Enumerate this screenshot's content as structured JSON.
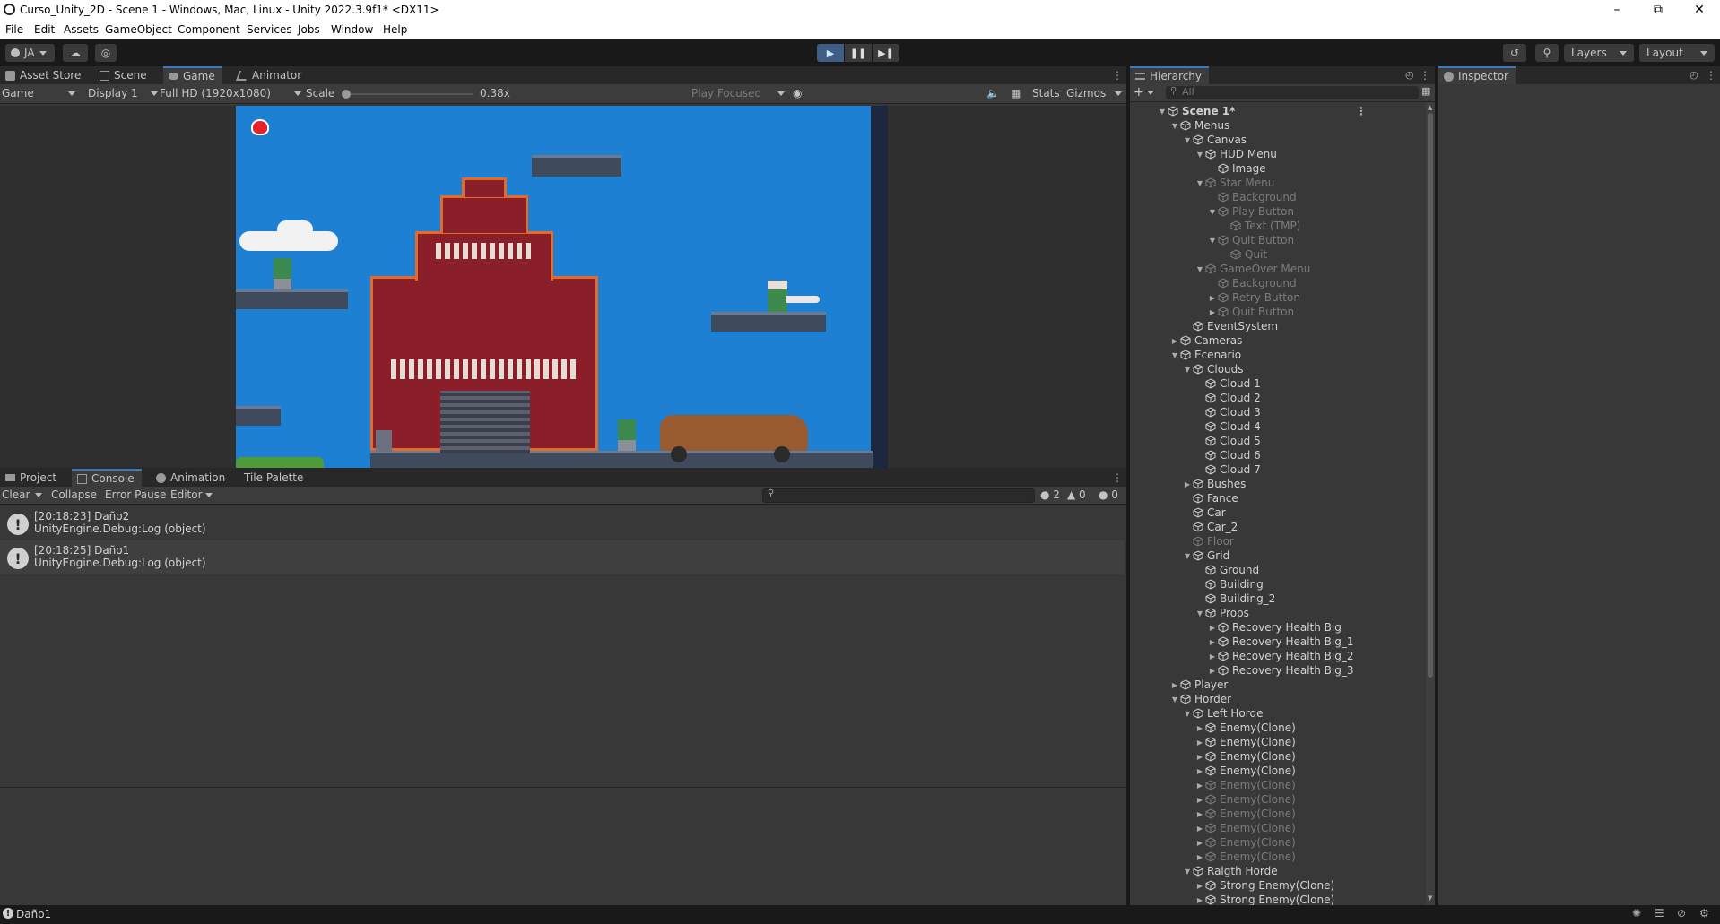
{
  "window": {
    "title": "Curso_Unity_2D - Scene 1 - Windows, Mac, Linux - Unity 2022.3.9f1* <DX11>"
  },
  "menu": [
    "File",
    "Edit",
    "Assets",
    "GameObject",
    "Component",
    "Services",
    "Jobs",
    "Window",
    "Help"
  ],
  "toolbar": {
    "account": "JA",
    "layers_label": "Layers",
    "layout_label": "Layout"
  },
  "scene_tabs": [
    "Asset Store",
    "Scene",
    "Game",
    "Animator"
  ],
  "game_bar": {
    "view": "Game",
    "display": "Display 1",
    "resolution": "Full HD (1920x1080)",
    "scale_label": "Scale",
    "scale_value": "0.38x",
    "play_mode": "Play Focused",
    "stats": "Stats",
    "gizmos": "Gizmos"
  },
  "bottom_tabs": [
    "Project",
    "Console",
    "Animation",
    "Tile Palette"
  ],
  "console_bar": {
    "clear": "Clear",
    "collapse": "Collapse",
    "error_pause": "Error Pause",
    "editor": "Editor",
    "count_log": "2",
    "count_warn": "0",
    "count_err": "0"
  },
  "console_logs": [
    {
      "line1": "[20:18:23] Daño2",
      "line2": "UnityEngine.Debug:Log (object)"
    },
    {
      "line1": "[20:18:25] Daño1",
      "line2": "UnityEngine.Debug:Log (object)"
    }
  ],
  "hierarchy": {
    "tab": "Hierarchy",
    "search_placeholder": "All",
    "items": [
      {
        "label": "Scene 1*",
        "depth": 0,
        "fold": "open",
        "dim": false,
        "bold": true
      },
      {
        "label": "Menus",
        "depth": 1,
        "fold": "open",
        "dim": false
      },
      {
        "label": "Canvas",
        "depth": 2,
        "fold": "open",
        "dim": false
      },
      {
        "label": "HUD Menu",
        "depth": 3,
        "fold": "open",
        "dim": false
      },
      {
        "label": "Image",
        "depth": 4,
        "fold": "none",
        "dim": false
      },
      {
        "label": "Star Menu",
        "depth": 3,
        "fold": "open",
        "dim": true
      },
      {
        "label": "Background",
        "depth": 4,
        "fold": "none",
        "dim": true
      },
      {
        "label": "Play Button",
        "depth": 4,
        "fold": "open",
        "dim": true
      },
      {
        "label": "Text (TMP)",
        "depth": 5,
        "fold": "none",
        "dim": true
      },
      {
        "label": "Quit Button",
        "depth": 4,
        "fold": "open",
        "dim": true
      },
      {
        "label": "Quit",
        "depth": 5,
        "fold": "none",
        "dim": true
      },
      {
        "label": "GameOver Menu",
        "depth": 3,
        "fold": "open",
        "dim": true
      },
      {
        "label": "Background",
        "depth": 4,
        "fold": "none",
        "dim": true
      },
      {
        "label": "Retry Button",
        "depth": 4,
        "fold": "closed",
        "dim": true
      },
      {
        "label": "Quit Button",
        "depth": 4,
        "fold": "closed",
        "dim": true
      },
      {
        "label": "EventSystem",
        "depth": 2,
        "fold": "none",
        "dim": false
      },
      {
        "label": "Cameras",
        "depth": 1,
        "fold": "closed",
        "dim": false
      },
      {
        "label": "Ecenario",
        "depth": 1,
        "fold": "open",
        "dim": false
      },
      {
        "label": "Clouds",
        "depth": 2,
        "fold": "open",
        "dim": false
      },
      {
        "label": "Cloud 1",
        "depth": 3,
        "fold": "none",
        "dim": false
      },
      {
        "label": "Cloud 2",
        "depth": 3,
        "fold": "none",
        "dim": false
      },
      {
        "label": "Cloud 3",
        "depth": 3,
        "fold": "none",
        "dim": false
      },
      {
        "label": "Cloud 4",
        "depth": 3,
        "fold": "none",
        "dim": false
      },
      {
        "label": "Cloud 5",
        "depth": 3,
        "fold": "none",
        "dim": false
      },
      {
        "label": "Cloud 6",
        "depth": 3,
        "fold": "none",
        "dim": false
      },
      {
        "label": "Cloud 7",
        "depth": 3,
        "fold": "none",
        "dim": false
      },
      {
        "label": "Bushes",
        "depth": 2,
        "fold": "closed",
        "dim": false
      },
      {
        "label": "Fance",
        "depth": 2,
        "fold": "none",
        "dim": false
      },
      {
        "label": "Car",
        "depth": 2,
        "fold": "none",
        "dim": false
      },
      {
        "label": "Car_2",
        "depth": 2,
        "fold": "none",
        "dim": false
      },
      {
        "label": "Floor",
        "depth": 2,
        "fold": "none",
        "dim": true
      },
      {
        "label": "Grid",
        "depth": 2,
        "fold": "open",
        "dim": false
      },
      {
        "label": "Ground",
        "depth": 3,
        "fold": "none",
        "dim": false
      },
      {
        "label": "Building",
        "depth": 3,
        "fold": "none",
        "dim": false
      },
      {
        "label": "Building_2",
        "depth": 3,
        "fold": "none",
        "dim": false
      },
      {
        "label": "Props",
        "depth": 3,
        "fold": "open",
        "dim": false
      },
      {
        "label": "Recovery Health Big",
        "depth": 4,
        "fold": "closed",
        "dim": false
      },
      {
        "label": "Recovery Health Big_1",
        "depth": 4,
        "fold": "closed",
        "dim": false
      },
      {
        "label": "Recovery Health Big_2",
        "depth": 4,
        "fold": "closed",
        "dim": false
      },
      {
        "label": "Recovery Health Big_3",
        "depth": 4,
        "fold": "closed",
        "dim": false
      },
      {
        "label": "Player",
        "depth": 1,
        "fold": "closed",
        "dim": false
      },
      {
        "label": "Horder",
        "depth": 1,
        "fold": "open",
        "dim": false
      },
      {
        "label": "Left Horde",
        "depth": 2,
        "fold": "open",
        "dim": false
      },
      {
        "label": "Enemy(Clone)",
        "depth": 3,
        "fold": "closed",
        "dim": false
      },
      {
        "label": "Enemy(Clone)",
        "depth": 3,
        "fold": "closed",
        "dim": false
      },
      {
        "label": "Enemy(Clone)",
        "depth": 3,
        "fold": "closed",
        "dim": false
      },
      {
        "label": "Enemy(Clone)",
        "depth": 3,
        "fold": "closed",
        "dim": false
      },
      {
        "label": "Enemy(Clone)",
        "depth": 3,
        "fold": "closed",
        "dim": true
      },
      {
        "label": "Enemy(Clone)",
        "depth": 3,
        "fold": "closed",
        "dim": true
      },
      {
        "label": "Enemy(Clone)",
        "depth": 3,
        "fold": "closed",
        "dim": true
      },
      {
        "label": "Enemy(Clone)",
        "depth": 3,
        "fold": "closed",
        "dim": true
      },
      {
        "label": "Enemy(Clone)",
        "depth": 3,
        "fold": "closed",
        "dim": true
      },
      {
        "label": "Enemy(Clone)",
        "depth": 3,
        "fold": "closed",
        "dim": true
      },
      {
        "label": "Raigth Horde",
        "depth": 2,
        "fold": "open",
        "dim": false
      },
      {
        "label": "Strong Enemy(Clone)",
        "depth": 3,
        "fold": "closed",
        "dim": false
      },
      {
        "label": "Strong Enemy(Clone)",
        "depth": 3,
        "fold": "closed",
        "dim": false
      }
    ]
  },
  "inspector": {
    "tab": "Inspector"
  },
  "status": {
    "message": "Daño1"
  },
  "colors": {
    "accent": "#3a79bb",
    "sky": "#1d80d3",
    "brick": "#8a1f2a"
  }
}
